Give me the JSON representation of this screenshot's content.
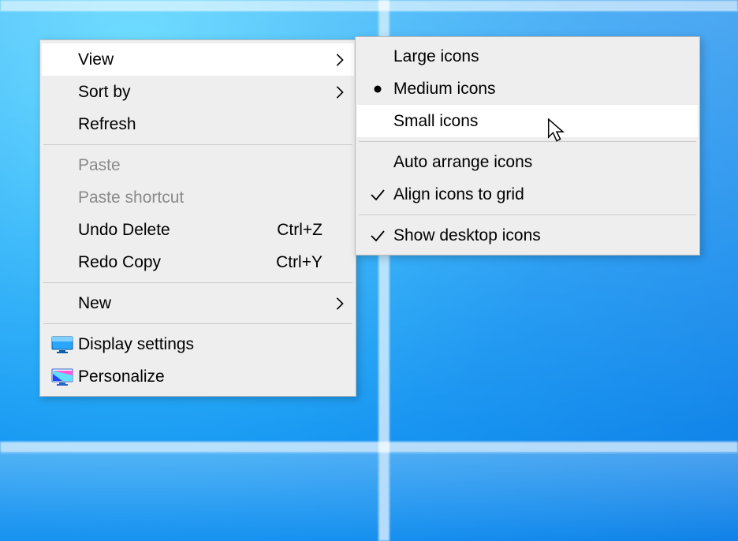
{
  "main_menu": {
    "view": {
      "label": "View"
    },
    "sort_by": {
      "label": "Sort by"
    },
    "refresh": {
      "label": "Refresh"
    },
    "paste": {
      "label": "Paste"
    },
    "paste_shortcut": {
      "label": "Paste shortcut"
    },
    "undo_delete": {
      "label": "Undo Delete",
      "shortcut": "Ctrl+Z"
    },
    "redo_copy": {
      "label": "Redo Copy",
      "shortcut": "Ctrl+Y"
    },
    "new": {
      "label": "New"
    },
    "display_settings": {
      "label": "Display settings"
    },
    "personalize": {
      "label": "Personalize"
    }
  },
  "view_submenu": {
    "large_icons": {
      "label": "Large icons"
    },
    "medium_icons": {
      "label": "Medium icons"
    },
    "small_icons": {
      "label": "Small icons"
    },
    "auto_arrange": {
      "label": "Auto arrange icons"
    },
    "align_to_grid": {
      "label": "Align icons to grid"
    },
    "show_desktop_icons": {
      "label": "Show desktop icons"
    }
  }
}
